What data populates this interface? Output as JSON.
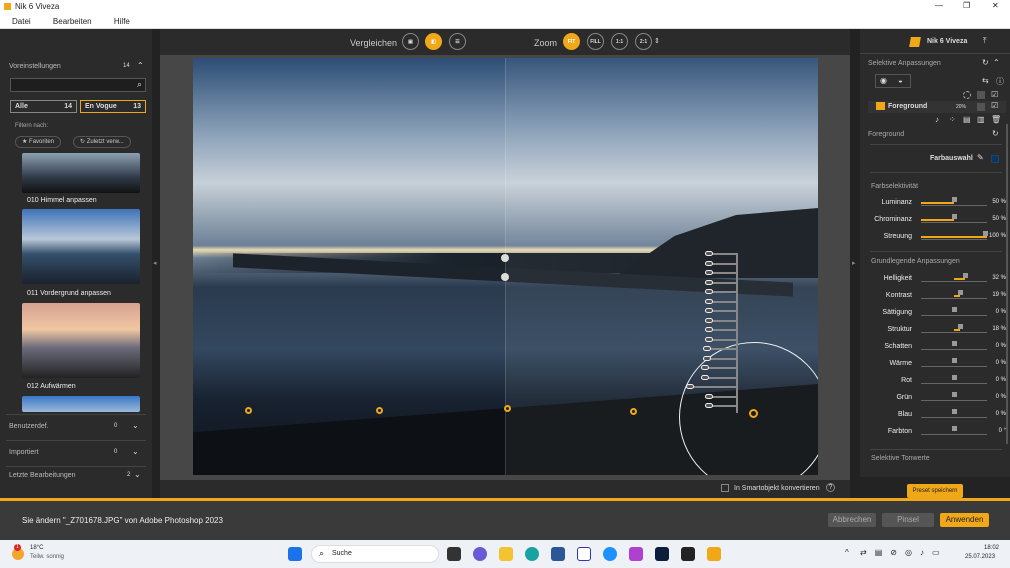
{
  "window": {
    "title": "Nik 6 Viveza"
  },
  "menu": [
    "Datei",
    "Bearbeiten",
    "Hilfe"
  ],
  "left": {
    "presets_label": "Voreinstellungen",
    "presets_count": "14",
    "tabs": [
      {
        "label": "Alle",
        "count": "14"
      },
      {
        "label": "En Vogue",
        "count": "13"
      }
    ],
    "filter_label": "Filtern nach:",
    "filters": [
      "★ Favoriten",
      "↻ Zuletzt verw..."
    ],
    "thumbs": [
      "010 Himmel anpassen",
      "011 Vordergrund anpassen",
      "012 Aufwärmen"
    ],
    "sections": [
      {
        "label": "Benutzerdef.",
        "count": "0"
      },
      {
        "label": "Importiert",
        "count": "0"
      },
      {
        "label": "Letzte Bearbeitungen",
        "count": "2"
      }
    ]
  },
  "toolbar": {
    "compare": "Vergleichen",
    "zoom": "Zoom",
    "zoom_options": [
      "FIT",
      "FILL",
      "1:1",
      "2:1"
    ]
  },
  "point": {
    "tags": [
      "ST Schw",
      "ST Sch",
      "ST Mi",
      "ST Sp",
      "H",
      "B",
      "G",
      "R",
      "Wä",
      "Sch",
      "St",
      "St",
      "Ko",
      "He"
    ],
    "labels": [
      "Üh",
      "Chr",
      "Lm"
    ],
    "tag_colors": {
      "B": "#3355dd",
      "G": "#22aa44",
      "R": "#dd3333"
    }
  },
  "smart_object": "In Smartobjekt konvertieren",
  "right": {
    "brand": "Nik 6 Viveza",
    "selective": "Selektive Anpassungen",
    "layer": {
      "name": "Foreground",
      "opacity": "20%"
    },
    "layer_title": "Foreground",
    "color_pick": "Farbauswahl",
    "color_sel_title": "Farbselektivität",
    "color_sel": [
      {
        "label": "Luminanz",
        "value": 50,
        "text": "50 %"
      },
      {
        "label": "Chrominanz",
        "value": 50,
        "text": "50 %"
      },
      {
        "label": "Streuung",
        "value": 100,
        "text": "100 %"
      }
    ],
    "basic_title": "Grundlegende Anpassungen",
    "basic": [
      {
        "label": "Helligkeit",
        "value": 32,
        "text": "32 %"
      },
      {
        "label": "Kontrast",
        "value": 19,
        "text": "19 %"
      },
      {
        "label": "Sättigung",
        "value": 0,
        "text": "0 %"
      },
      {
        "label": "Struktur",
        "value": 18,
        "text": "18 %"
      },
      {
        "label": "Schatten",
        "value": 0,
        "text": "0 %"
      },
      {
        "label": "Wärme",
        "value": 0,
        "text": "0 %"
      },
      {
        "label": "Rot",
        "value": 0,
        "text": "0 %"
      },
      {
        "label": "Grün",
        "value": 0,
        "text": "0 %"
      },
      {
        "label": "Blau",
        "value": 0,
        "text": "0 %"
      },
      {
        "label": "Farbton",
        "value": 0,
        "text": "0 °"
      }
    ],
    "tonal_title": "Selektive Tonwerte",
    "save_preset": "Preset speichern"
  },
  "footer": {
    "message": "Sie ändern \"_Z701678.JPG\" von Adobe Photoshop 2023",
    "cancel": "Abbrechen",
    "brush": "Pinsel",
    "apply": "Anwenden"
  },
  "taskbar": {
    "temp": "18°C",
    "weather": "Teilw. sonnig",
    "badge": "1",
    "search": "Suche",
    "time": "18:02",
    "date": "25.07.2023"
  },
  "colors": {
    "accent": "#f0a818",
    "panel": "#2b2b2b"
  }
}
